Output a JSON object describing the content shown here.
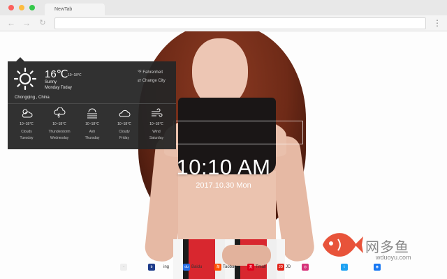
{
  "browser": {
    "tab_title": "NewTab",
    "nav": {
      "back": "←",
      "forward": "→",
      "reload": "↻",
      "menu": "⋮"
    }
  },
  "clock": {
    "time": "10:10 AM",
    "date": "2017.10.30 Mon"
  },
  "weather": {
    "temp": "16℃",
    "range": "10~18℃",
    "condition": "Sunny",
    "day": "Monday Today",
    "location": "Chongqing , China",
    "fahrenheit_label": "℉ Fahrenheit",
    "change_city_label": "⇄ Change City",
    "forecast": [
      {
        "icon": "partly-cloudy-icon",
        "range": "10~18℃",
        "condition": "Cloudy",
        "day": "Tuesday"
      },
      {
        "icon": "thunderstorm-icon",
        "range": "10~18℃",
        "condition": "Thunderstorm",
        "day": "Wednesday"
      },
      {
        "icon": "ash-icon",
        "range": "10~18℃",
        "condition": "Ash",
        "day": "Thursday"
      },
      {
        "icon": "cloud-icon",
        "range": "10~18℃",
        "condition": "Cloudy",
        "day": "Friday"
      },
      {
        "icon": "wind-icon",
        "range": "10~18℃",
        "condition": "Wind",
        "day": "Saturday"
      }
    ]
  },
  "shortcuts": [
    {
      "name": "shortcut-1",
      "label": "",
      "color": "#eeeeee"
    },
    {
      "name": "shortcut-2",
      "label": "ing",
      "color": "#1d3b8a"
    },
    {
      "name": "shortcut-baidu",
      "label": "Baidu",
      "color": "#2b6de3"
    },
    {
      "name": "shortcut-taobao",
      "label": "Taobao",
      "color": "#ff5000"
    },
    {
      "name": "shortcut-tmall",
      "label": "Tmall",
      "color": "#e0001b"
    },
    {
      "name": "shortcut-jd",
      "label": "JD",
      "color": "#e1251b"
    },
    {
      "name": "shortcut-instagram",
      "label": "",
      "color": "#d6337a"
    },
    {
      "name": "shortcut-twitter",
      "label": "",
      "color": "#1da1f2"
    },
    {
      "name": "shortcut-facebook",
      "label": "",
      "color": "#1877f2"
    }
  ],
  "watermark": {
    "cn": "网多鱼",
    "url": "wduoyu.com"
  },
  "colors": {
    "panel_bg": "#262626",
    "fish_red": "#e8533a"
  }
}
